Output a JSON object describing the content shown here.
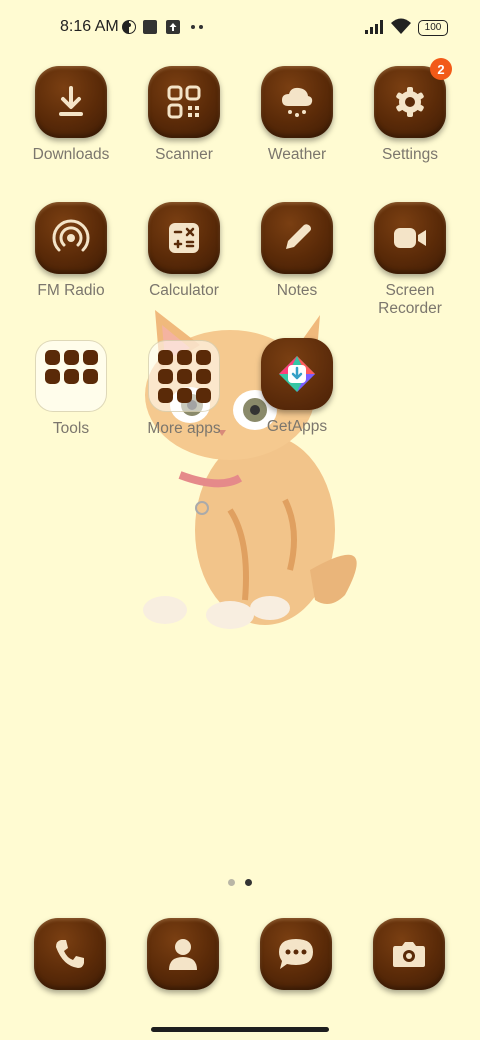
{
  "status_bar": {
    "time": "8:16 AM",
    "battery": "100",
    "icons": [
      "theme-icon",
      "square-notification-icon",
      "upload-icon",
      "more-dots-icon",
      "signal-icon",
      "wifi-icon",
      "battery-icon"
    ]
  },
  "apps": {
    "downloads": "Downloads",
    "scanner": "Scanner",
    "weather": "Weather",
    "settings": "Settings",
    "settings_badge": "2",
    "fm_radio": "FM Radio",
    "calculator": "Calculator",
    "notes": "Notes",
    "screen_recorder": "Screen Recorder",
    "tools": "Tools",
    "more_apps": "More apps",
    "getapps": "GetApps"
  },
  "pager": {
    "current_page": 2,
    "page_count": 2
  },
  "dock": [
    "phone-icon",
    "contacts-icon",
    "messages-icon",
    "camera-icon"
  ],
  "colors": {
    "background": "#fffbd2",
    "icon_tile": "#5a2a08",
    "badge": "#f25a18",
    "label": "#7b766d"
  }
}
